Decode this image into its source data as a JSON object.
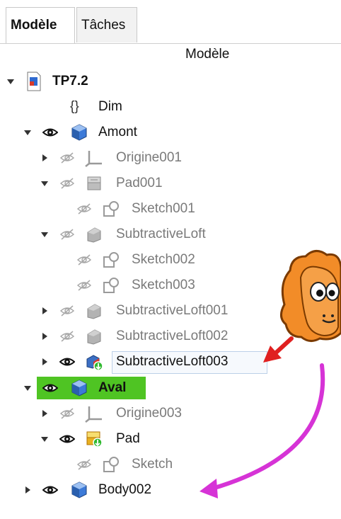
{
  "tabs": [
    {
      "label": "Modèle",
      "active": true
    },
    {
      "label": "Tâches",
      "active": false
    }
  ],
  "tree_header": "Modèle",
  "tree": [
    {
      "label": "TP7.2",
      "bold": true,
      "icon": "document-icon"
    },
    {
      "label": "Dim",
      "icon": "spreadsheet-icon"
    },
    {
      "label": "Amont",
      "icon": "body-icon",
      "visible": true
    },
    {
      "label": "Origine001",
      "icon": "origin-icon",
      "visible": false
    },
    {
      "label": "Pad001",
      "icon": "pad-icon",
      "visible": false
    },
    {
      "label": "Sketch001",
      "icon": "sketch-icon",
      "visible": false
    },
    {
      "label": "SubtractiveLoft",
      "icon": "subtractive-loft-icon",
      "visible": false
    },
    {
      "label": "Sketch002",
      "icon": "sketch-icon",
      "visible": false
    },
    {
      "label": "Sketch003",
      "icon": "sketch-icon",
      "visible": false
    },
    {
      "label": "SubtractiveLoft001",
      "icon": "subtractive-loft-icon",
      "visible": false
    },
    {
      "label": "SubtractiveLoft002",
      "icon": "subtractive-loft-icon",
      "visible": false
    },
    {
      "label": "SubtractiveLoft003",
      "icon": "subtractive-loft-icon",
      "visible": true,
      "selected": true
    },
    {
      "label": "Aval",
      "bold": true,
      "icon": "body-icon",
      "visible": true,
      "highlight_color": "#4fc423"
    },
    {
      "label": "Origine003",
      "icon": "origin-icon",
      "visible": false
    },
    {
      "label": "Pad",
      "icon": "pad-icon",
      "visible": true
    },
    {
      "label": "Sketch",
      "icon": "sketch-icon",
      "visible": false
    },
    {
      "label": "Body002",
      "icon": "body-icon",
      "visible": true
    }
  ],
  "annotations": {
    "red_arrow_color": "#e02020",
    "magenta_arrow_color": "#d633d6",
    "mascot": "sheep-mascot-icon"
  }
}
